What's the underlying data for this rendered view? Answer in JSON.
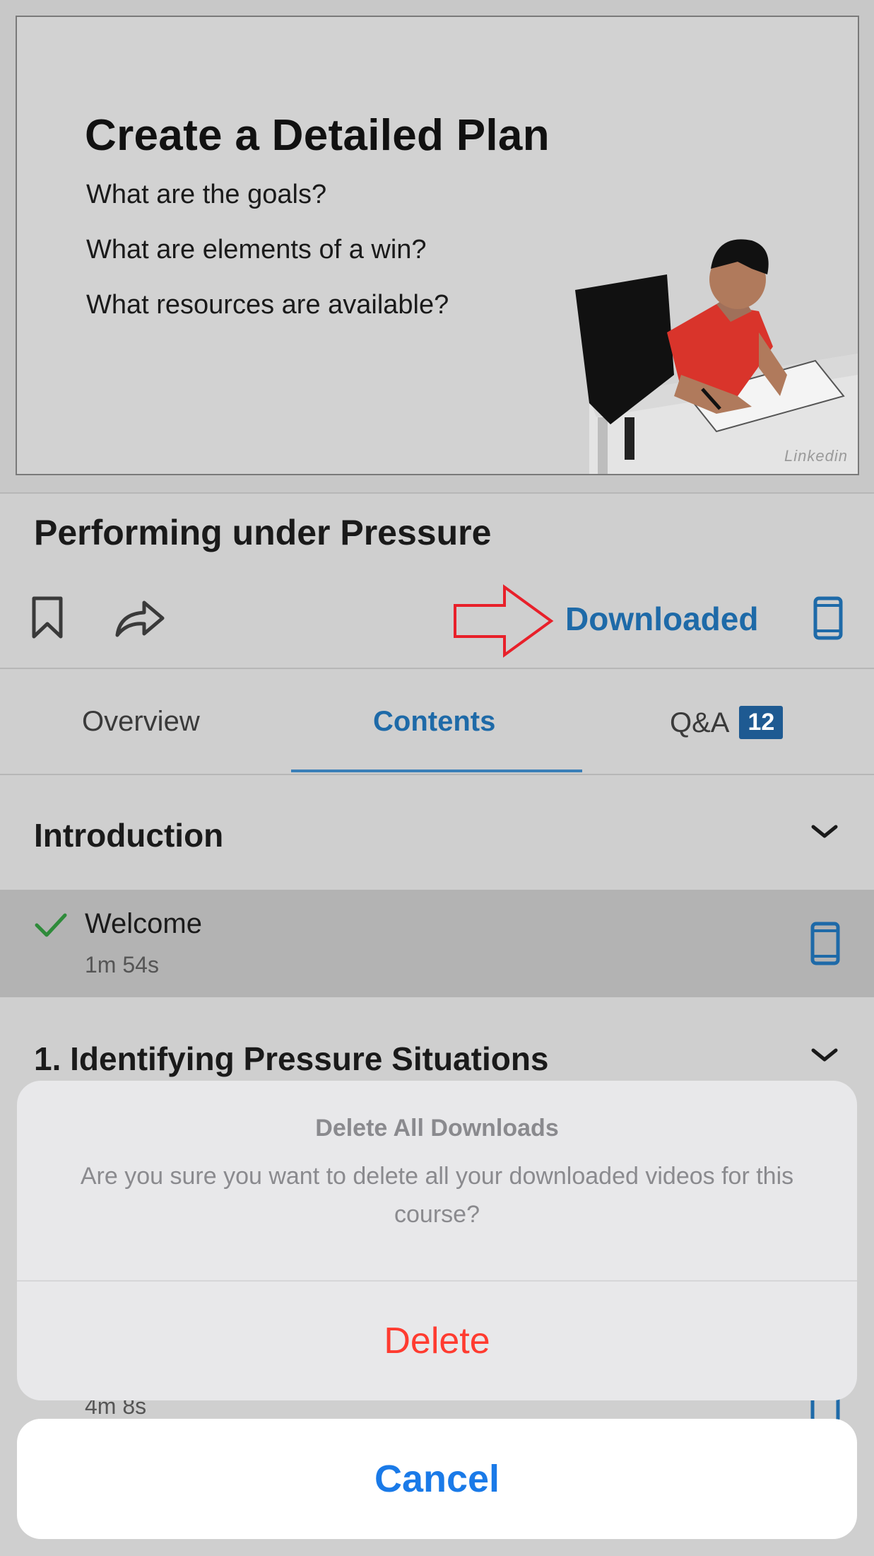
{
  "video": {
    "slide_title": "Create a Detailed Plan",
    "questions": [
      "What are the goals?",
      "What are elements of a win?",
      "What resources are available?"
    ],
    "watermark": "Linkedin"
  },
  "course": {
    "title": "Performing under Pressure",
    "downloaded_label": "Downloaded"
  },
  "tabs": [
    {
      "label": "Overview"
    },
    {
      "label": "Contents",
      "active": true
    },
    {
      "label": "Q&A",
      "badge": "12"
    }
  ],
  "sections": [
    {
      "title": "Introduction",
      "videos": [
        {
          "title": "Welcome",
          "duration": "1m 54s",
          "watched": true
        }
      ]
    },
    {
      "title": "1. Identifying Pressure Situations",
      "videos": [
        {
          "duration": "4m 8s"
        }
      ]
    }
  ],
  "action_sheet": {
    "title": "Delete All Downloads",
    "message": "Are you sure you want to delete all your downloaded videos for this course?",
    "delete_label": "Delete",
    "cancel_label": "Cancel"
  },
  "colors": {
    "accent_blue": "#1e6aa8",
    "delete_red": "#ff3b30",
    "cancel_blue": "#1a7ae8",
    "annotation_red": "#e8202a",
    "check_green": "#2e8b3a"
  },
  "icons": [
    "bookmark-icon",
    "share-icon",
    "red-arrow-annotation",
    "mobile-device-icon",
    "chevron-down-icon",
    "checkmark-icon"
  ]
}
